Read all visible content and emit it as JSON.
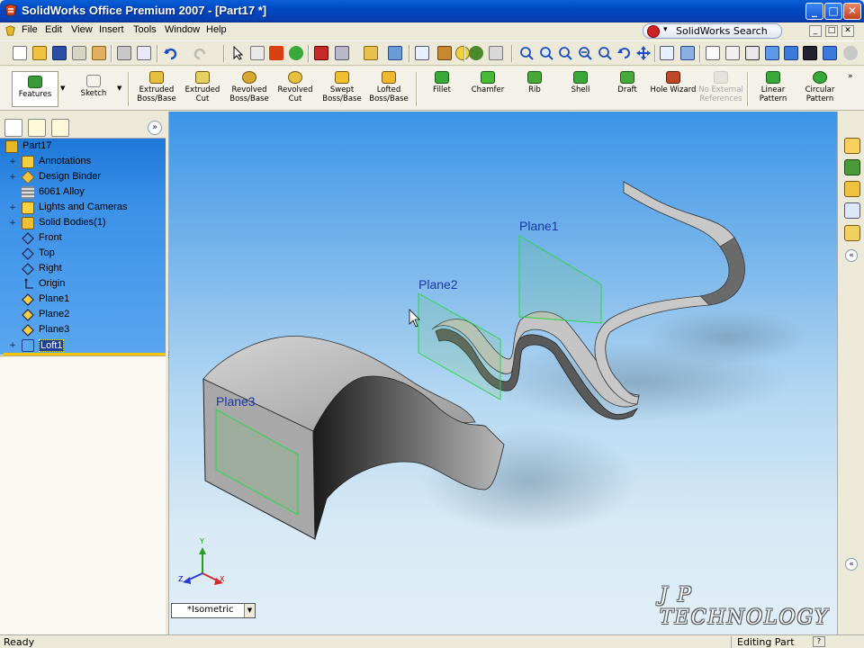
{
  "window": {
    "title": "SolidWorks Office Premium 2007 - [Part17 *]",
    "minimize": "_",
    "maximize": "□",
    "close": "✕"
  },
  "menu": {
    "items": [
      "File",
      "Edit",
      "View",
      "Insert",
      "Tools",
      "Window",
      "Help"
    ],
    "search_label": "SolidWorks Search",
    "mdi": [
      "_",
      "□",
      "✕"
    ]
  },
  "command_manager": {
    "tabs": [
      {
        "label": "Features",
        "icon": "features-icon"
      },
      {
        "label": "Sketch",
        "icon": "sketch-icon"
      }
    ],
    "commands": [
      {
        "label": "Extruded Boss/Base",
        "line1": "Extruded",
        "line2": "Boss/Base",
        "icon": "extruded-boss-icon",
        "enabled": true
      },
      {
        "label": "Extruded Cut",
        "line1": "Extruded",
        "line2": "Cut",
        "icon": "extruded-cut-icon",
        "enabled": true
      },
      {
        "label": "Revolved Boss/Base",
        "line1": "Revolved",
        "line2": "Boss/Base",
        "icon": "revolved-boss-icon",
        "enabled": true
      },
      {
        "label": "Revolved Cut",
        "line1": "Revolved",
        "line2": "Cut",
        "icon": "revolved-cut-icon",
        "enabled": true
      },
      {
        "label": "Swept Boss/Base",
        "line1": "Swept",
        "line2": "Boss/Base",
        "icon": "swept-boss-icon",
        "enabled": true
      },
      {
        "label": "Lofted Boss/Base",
        "line1": "Lofted",
        "line2": "Boss/Base",
        "icon": "lofted-boss-icon",
        "enabled": true
      },
      {
        "label": "Fillet",
        "line1": "Fillet",
        "line2": "",
        "icon": "fillet-icon",
        "enabled": true
      },
      {
        "label": "Chamfer",
        "line1": "Chamfer",
        "line2": "",
        "icon": "chamfer-icon",
        "enabled": true
      },
      {
        "label": "Rib",
        "line1": "Rib",
        "line2": "",
        "icon": "rib-icon",
        "enabled": true
      },
      {
        "label": "Shell",
        "line1": "Shell",
        "line2": "",
        "icon": "shell-icon",
        "enabled": true
      },
      {
        "label": "Draft",
        "line1": "Draft",
        "line2": "",
        "icon": "draft-icon",
        "enabled": true
      },
      {
        "label": "Hole Wizard",
        "line1": "Hole Wizard",
        "line2": "",
        "icon": "hole-wizard-icon",
        "enabled": true
      },
      {
        "label": "No External References",
        "line1": "No External",
        "line2": "References",
        "icon": "no-external-references-icon",
        "enabled": false
      },
      {
        "label": "Linear Pattern",
        "line1": "Linear",
        "line2": "Pattern",
        "icon": "linear-pattern-icon",
        "enabled": true
      },
      {
        "label": "Circular Pattern",
        "line1": "Circular",
        "line2": "Pattern",
        "icon": "circular-pattern-icon",
        "enabled": true
      }
    ]
  },
  "feature_tree": {
    "root": "Part17",
    "items": [
      {
        "label": "Annotations",
        "icon": "annotations-icon",
        "expandable": true
      },
      {
        "label": "Design Binder",
        "icon": "design-binder-icon",
        "expandable": true
      },
      {
        "label": "6061 Alloy",
        "icon": "material-icon",
        "expandable": false
      },
      {
        "label": "Lights and Cameras",
        "icon": "lights-cameras-icon",
        "expandable": true
      },
      {
        "label": "Solid Bodies(1)",
        "icon": "solid-bodies-icon",
        "expandable": true
      },
      {
        "label": "Front",
        "icon": "plane-icon",
        "expandable": false
      },
      {
        "label": "Top",
        "icon": "plane-icon",
        "expandable": false
      },
      {
        "label": "Right",
        "icon": "plane-icon",
        "expandable": false
      },
      {
        "label": "Origin",
        "icon": "origin-icon",
        "expandable": false
      },
      {
        "label": "Plane1",
        "icon": "plane-icon",
        "expandable": false
      },
      {
        "label": "Plane2",
        "icon": "plane-icon",
        "expandable": false
      },
      {
        "label": "Plane3",
        "icon": "plane-icon",
        "expandable": false
      },
      {
        "label": "Loft1",
        "icon": "loft-icon",
        "expandable": true,
        "selected": true
      }
    ]
  },
  "viewport": {
    "plane_labels": [
      "Plane1",
      "Plane2",
      "Plane3"
    ],
    "view_orientation": "*Isometric",
    "watermark": "J P TECHNOLOGY",
    "triad_axes": [
      "Y",
      "X",
      "Z"
    ]
  },
  "status": {
    "left": "Ready",
    "mode": "Editing Part",
    "help": "?"
  },
  "colors": {
    "tree_bg": "#3a90e8",
    "plane_outline": "#2bd44a",
    "plane_label": "#1a38a8"
  }
}
